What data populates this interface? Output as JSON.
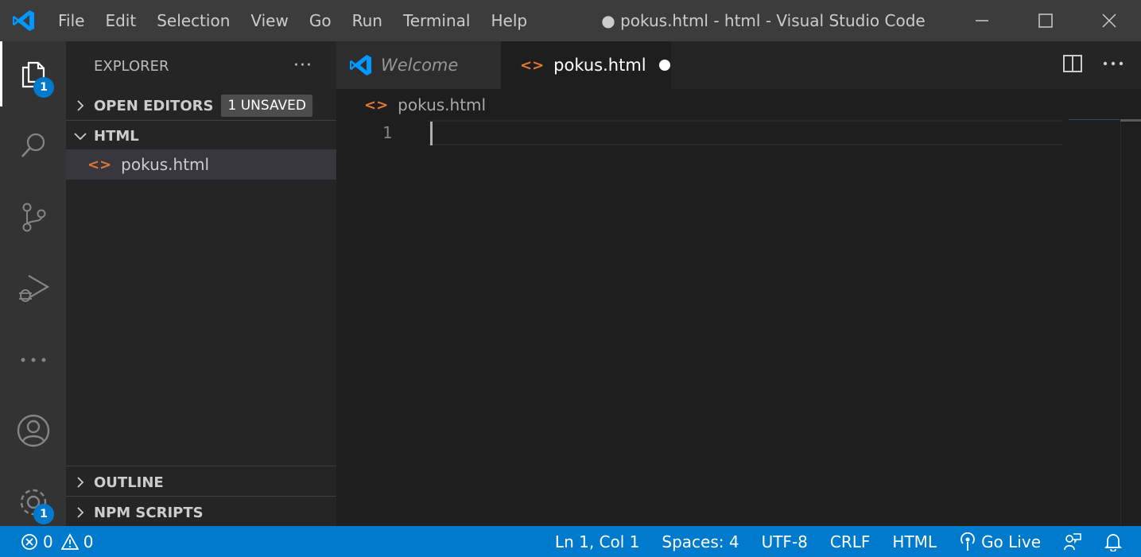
{
  "titlebar": {
    "menu": [
      "File",
      "Edit",
      "Selection",
      "View",
      "Go",
      "Run",
      "Terminal",
      "Help"
    ],
    "window_title": "● pokus.html - html - Visual Studio Code",
    "accent": "#0098ff"
  },
  "activitybar": {
    "explorer_badge": "1",
    "settings_badge": "1"
  },
  "sidebar": {
    "title": "EXPLORER",
    "more_label": "···",
    "open_editors": {
      "label": "OPEN EDITORS",
      "badge": "1 UNSAVED"
    },
    "folder": {
      "label": "HTML"
    },
    "files": [
      {
        "name": "pokus.html",
        "icon": "html-file-icon"
      }
    ],
    "outline": "OUTLINE",
    "npm_scripts": "NPM SCRIPTS"
  },
  "tabs": [
    {
      "label": "Welcome",
      "active": false
    },
    {
      "label": "pokus.html",
      "active": true,
      "dirty": true
    }
  ],
  "breadcrumb": {
    "file": "pokus.html"
  },
  "editor": {
    "line_numbers": [
      "1"
    ]
  },
  "statusbar": {
    "errors": "0",
    "warnings": "0",
    "position": "Ln 1, Col 1",
    "indent": "Spaces: 4",
    "encoding": "UTF-8",
    "eol": "CRLF",
    "language": "HTML",
    "go_live": "Go Live",
    "color": "#007acc"
  }
}
